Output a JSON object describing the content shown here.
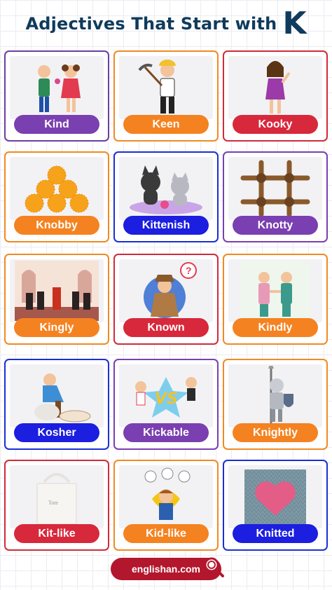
{
  "header": {
    "title": "Adjectives That Start with",
    "letter": "K"
  },
  "cards": [
    {
      "word": "Kind",
      "border": "#6b3fa0",
      "label_color": "#7a3fb0",
      "icon": "two-children-sharing-icon"
    },
    {
      "word": "Keen",
      "border": "#f08a24",
      "label_color": "#f58220",
      "icon": "worker-with-pickaxe-icon"
    },
    {
      "word": "Kooky",
      "border": "#d02b3a",
      "label_color": "#d8283c",
      "icon": "girl-laughing-icon"
    },
    {
      "word": "Knobby",
      "border": "#f08a24",
      "label_color": "#f58220",
      "icon": "knobby-balls-icon"
    },
    {
      "word": "Kittenish",
      "border": "#1a2fd6",
      "label_color": "#1c1ee0",
      "icon": "kittens-playing-icon"
    },
    {
      "word": "Knotty",
      "border": "#7a3fb0",
      "label_color": "#7a3fb0",
      "icon": "rope-knots-icon"
    },
    {
      "word": "Kingly",
      "border": "#f08a24",
      "label_color": "#f58220",
      "icon": "king-court-icon"
    },
    {
      "word": "Known",
      "border": "#d02b3a",
      "label_color": "#d8283c",
      "icon": "detective-question-icon"
    },
    {
      "word": "Kindly",
      "border": "#f08a24",
      "label_color": "#f58220",
      "icon": "doctors-handshake-icon"
    },
    {
      "word": "Kosher",
      "border": "#1a2fd6",
      "label_color": "#1c1ee0",
      "icon": "shearing-sheep-icon"
    },
    {
      "word": "Kickable",
      "border": "#7a3fb0",
      "label_color": "#7a3fb0",
      "icon": "kickers-versus-icon"
    },
    {
      "word": "Knightly",
      "border": "#f08a24",
      "label_color": "#f58220",
      "icon": "knight-icon"
    },
    {
      "word": "Kit-like",
      "border": "#d02b3a",
      "label_color": "#d8283c",
      "icon": "tote-bag-icon"
    },
    {
      "word": "Kid-like",
      "border": "#f08a24",
      "label_color": "#f58220",
      "icon": "kid-with-ideas-icon"
    },
    {
      "word": "Knitted",
      "border": "#1a2fd6",
      "label_color": "#1c1ee0",
      "icon": "knitted-heart-icon"
    }
  ],
  "footer": {
    "site": "englishan.com"
  }
}
